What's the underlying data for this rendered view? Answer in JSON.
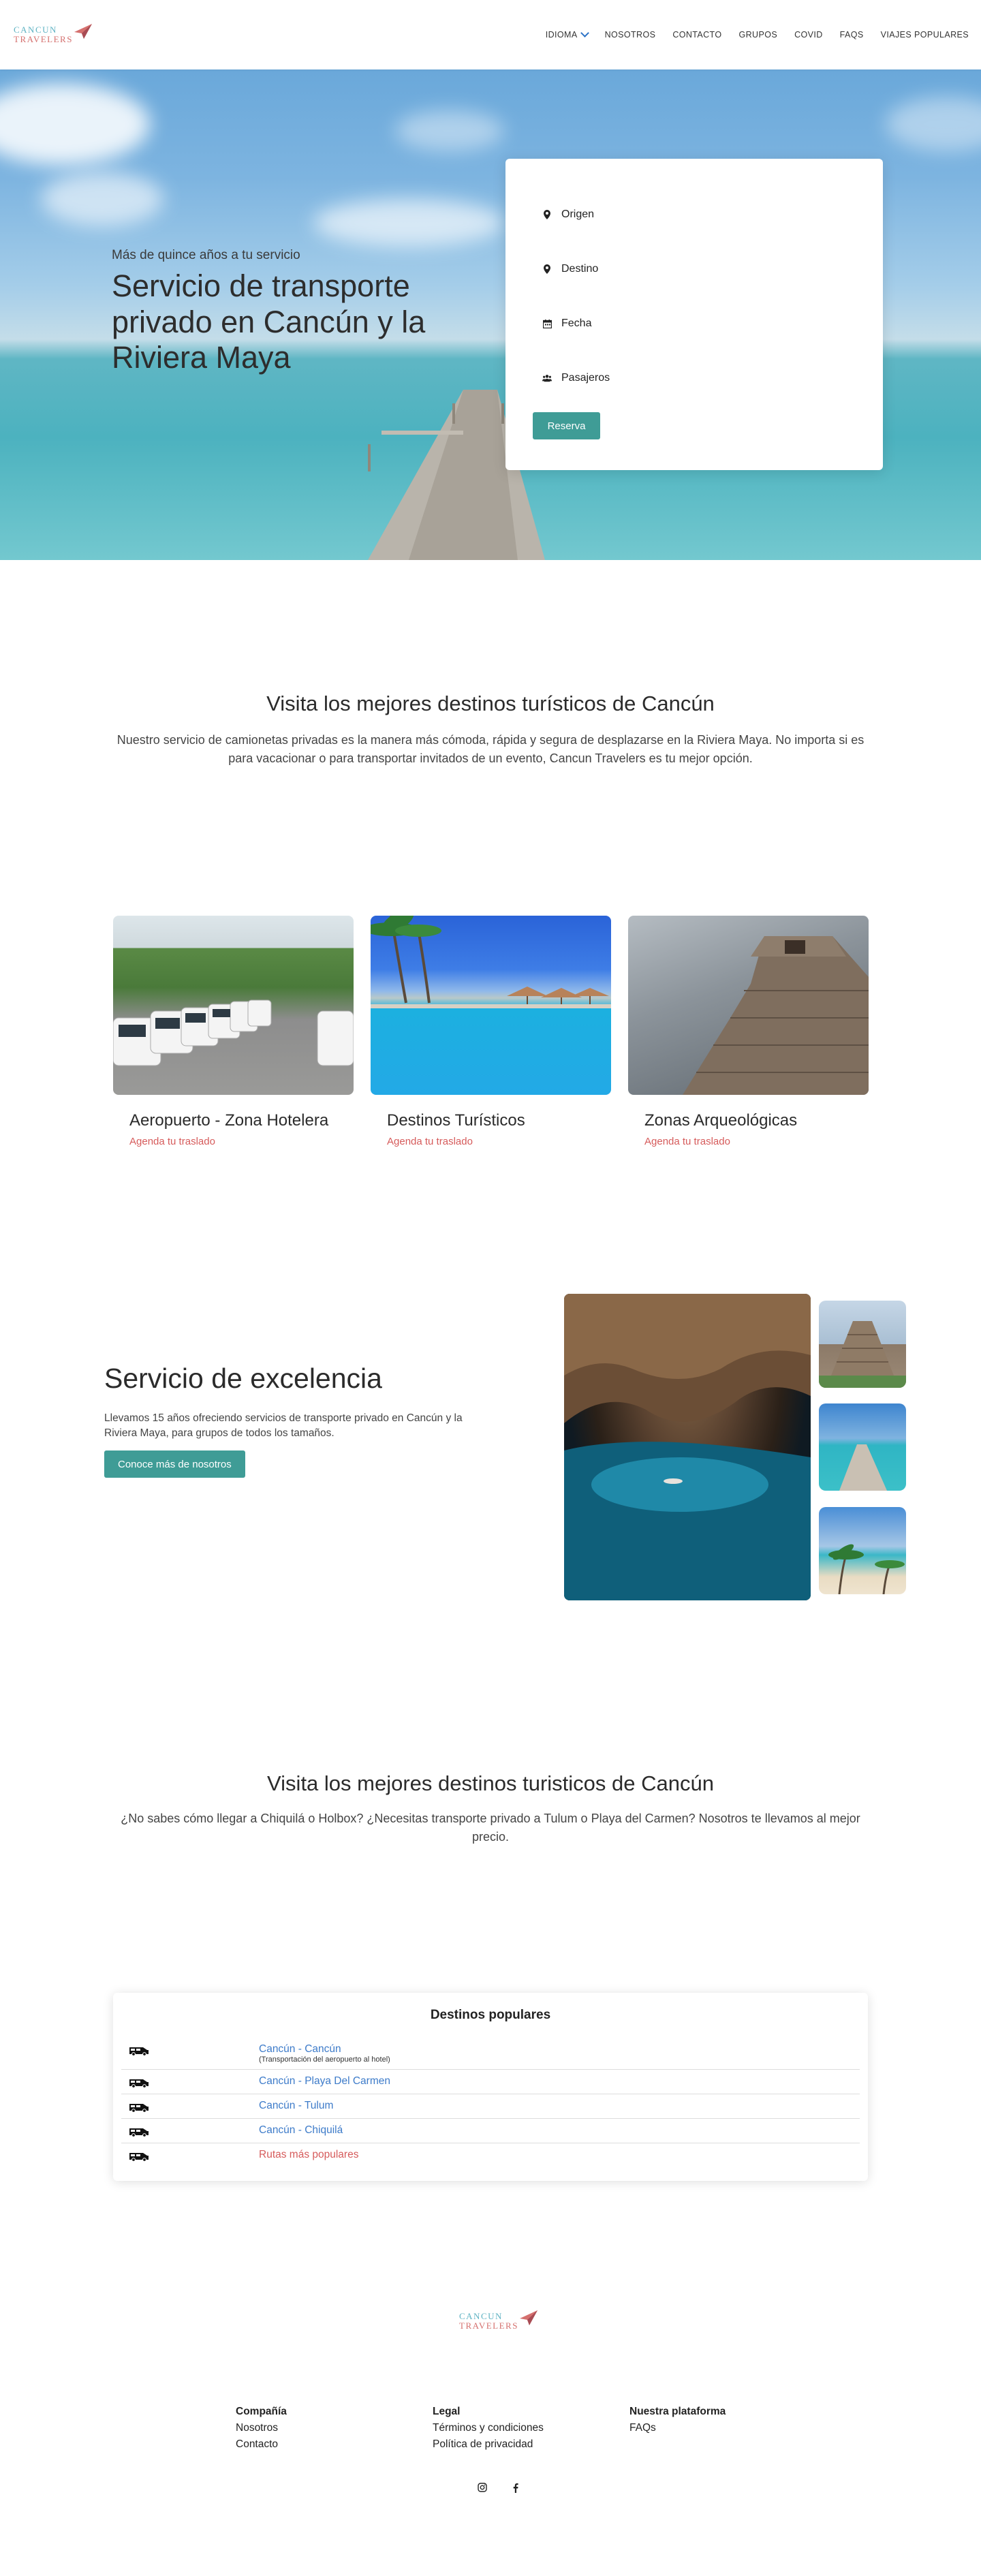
{
  "nav": {
    "logo_line1": "Cancun",
    "logo_line2": "Travelers",
    "items": [
      "Idioma",
      "Nosotros",
      "Contacto",
      "Grupos",
      "Covid",
      "FAQs",
      "Viajes populares"
    ]
  },
  "hero": {
    "subtitle": "Más de quince años a tu servicio",
    "title": "Servicio de transporte privado en Cancún y la Riviera Maya",
    "form": {
      "origin": "Origen",
      "destination": "Destino",
      "date": "Fecha",
      "passengers": "Pasajeros",
      "submit": "Reserva"
    }
  },
  "intro": {
    "title": "Visita los mejores destinos turísticos de Cancún",
    "description": "Nuestro servicio de camionetas privadas es la manera más cómoda, rápida y segura de desplazarse en la Riviera Maya. No importa si es para vacacionar o para transportar invitados de un evento, Cancun Travelers es tu mejor opción."
  },
  "cards": [
    {
      "title": "Aeropuerto - Zona Hotelera",
      "link": "Agenda tu traslado",
      "image": "white-vans-parked"
    },
    {
      "title": "Destinos Turísticos",
      "link": "Agenda tu traslado",
      "image": "resort-pool-palms"
    },
    {
      "title": "Zonas Arqueológicas",
      "link": "Agenda tu traslado",
      "image": "mayan-pyramid"
    }
  ],
  "excellence": {
    "title": "Servicio de excelencia",
    "body": "Llevamos 15 años ofreciendo servicios de transporte privado en Cancún y la Riviera Maya, para grupos de todos los tamaños.",
    "button": "Conoce más de nosotros"
  },
  "popular": {
    "title": "Visita los mejores destinos turisticos de Cancún",
    "description": "¿No sabes cómo llegar a Chiquilá o Holbox? ¿Necesitas transporte privado a Tulum o Playa del Carmen? Nosotros te llevamos al mejor precio."
  },
  "destinations": {
    "title": "Destinos populares",
    "rows": [
      {
        "label": "Cancún - Cancún",
        "note": "(Transportación del aeropuerto al hotel)"
      },
      {
        "label": "Cancún - Playa Del Carmen",
        "note": ""
      },
      {
        "label": "Cancún - Tulum",
        "note": ""
      },
      {
        "label": "Cancún - Chiquilá",
        "note": ""
      },
      {
        "label": "Rutas más populares",
        "note": ""
      }
    ]
  },
  "footer": {
    "logo_line1": "Cancun",
    "logo_line2": "Travelers",
    "columns": [
      {
        "heading": "Compañía",
        "links": [
          "Nosotros",
          "Contacto"
        ]
      },
      {
        "heading": "Legal",
        "links": [
          "Términos y condiciones",
          "Política de privacidad"
        ]
      },
      {
        "heading": "Nuestra plataforma",
        "links": [
          "FAQs"
        ]
      }
    ],
    "socials": [
      "instagram-icon",
      "facebook-icon"
    ]
  },
  "colors": {
    "teal": "#3f9c96",
    "link_blue": "#3d7bc9",
    "link_red": "#d65b5b",
    "logo_teal": "#5fb3c3",
    "logo_red": "#d5706e"
  }
}
